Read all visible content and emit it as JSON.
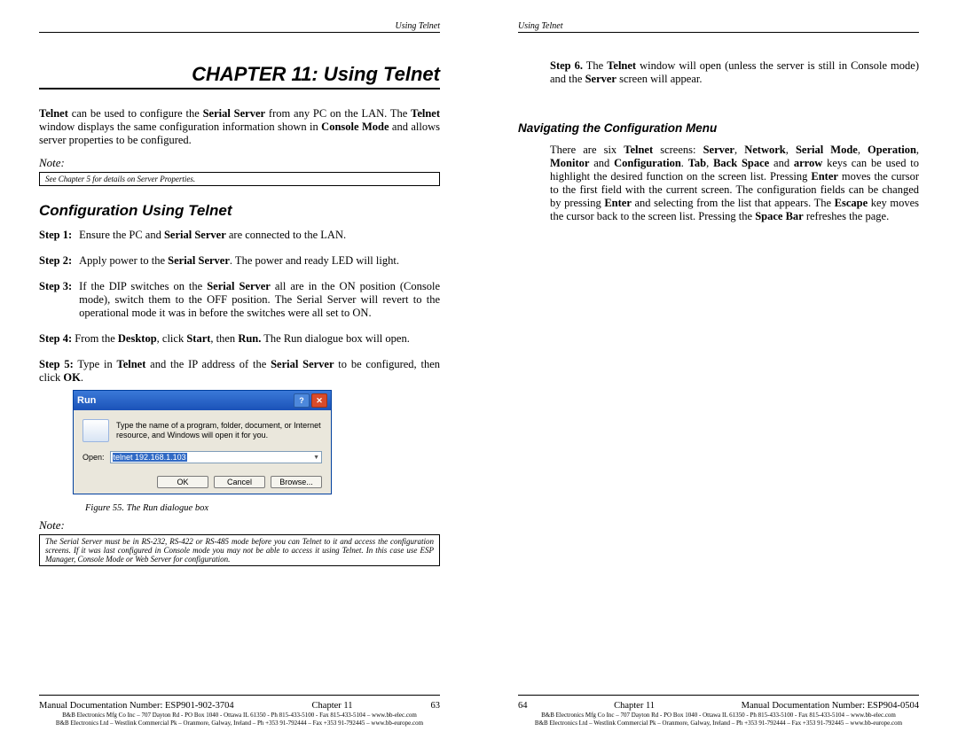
{
  "header_left": "Using Telnet",
  "header_right": "Using Telnet",
  "chapter_title": "CHAPTER 11: Using Telnet",
  "intro_html": "<b>Telnet</b> can be used to configure the <b>Serial Server</b> from any PC on the LAN. The <b>Telnet</b> window displays the same configuration information shown in <b>Console Mode</b> and allows server properties to be configured.",
  "note1_label": "Note:",
  "note1_text": "See Chapter 5 for details on Server Properties.",
  "h2_config": "Configuration Using Telnet",
  "step1_label": "Step 1:",
  "step1_html": "Ensure the PC and <b>Serial Server</b> are connected to the LAN.",
  "step2_label": "Step 2:",
  "step2_html": "Apply power to the <b>Serial Server</b>. The power and ready LED will light.",
  "step3_label": "Step 3:",
  "step3_html": "If the DIP switches on the <b>Serial Server</b> all are in the ON position (Console mode), switch them to the OFF position. The Serial Server will revert to the operational mode it was in before the switches were all set to ON.",
  "step4_html": "<b>Step 4:</b> From the <b>Desktop</b>, click <b>Start</b>, then <b>Run.</b> The Run dialogue box will open.",
  "step5_html": "<b>Step 5:</b> Type in <b>Telnet</b> and the IP address of the <b>Serial Server</b> to be configured, then click <b>OK</b>.",
  "run": {
    "title": "Run",
    "msg": "Type the name of a program, folder, document, or Internet resource, and Windows will open it for you.",
    "open_label": "Open:",
    "open_value": "telnet 192.168.1.103",
    "ok": "OK",
    "cancel": "Cancel",
    "browse": "Browse..."
  },
  "fig_caption": "Figure 55.    The Run dialogue box",
  "note2_label": "Note:",
  "note2_text": "The Serial Server must be in RS-232, RS-422 or RS-485 mode before you can Telnet to it and access the configuration screens. If it was last configured in Console mode you may not be able to access it using Telnet. In this case use ESP Manager, Console Mode or Web Server for configuration.",
  "step6_html": "<b>Step 6.</b> The <b>Telnet</b> window will open (unless the server is still in Console mode) and the <b>Server</b> screen will appear.",
  "h3_nav": "Navigating the Configuration Menu",
  "nav_html": "There are six <b>Telnet</b> screens: <b>Server</b>, <b>Network</b>, <b>Serial Mode</b>, <b>Operation</b>, <b>Monitor</b> and <b>Configuration</b>. <b>Tab</b>, <b>Back Space</b> and <b>arrow</b> keys can be used to highlight the desired function on the screen list. Pressing <b>Enter</b> moves the cursor to the first field with the current screen. The configuration fields can be changed by pressing <b>Enter</b> and selecting from the list that appears. The <b>Escape</b> key moves the cursor back to the screen list. Pressing the <b>Space Bar</b> refreshes the page.",
  "footer_left": {
    "docnum": "Manual Documentation Number: ESP901-902-3704",
    "chapter": "Chapter 11",
    "page": "63",
    "fine1": "B&B Electronics Mfg Co Inc – 707 Dayton Rd - PO Box 1040 - Ottawa IL 61350 - Ph 815-433-5100 - Fax 815-433-5104 – www.bb-elec.com",
    "fine2": "B&B Electronics Ltd – Westlink Commercial Pk – Oranmore, Galway, Ireland – Ph +353 91-792444 – Fax +353 91-792445 – www.bb-europe.com"
  },
  "footer_right": {
    "docnum": "Manual Documentation Number: ESP904-0504",
    "chapter": "Chapter 11",
    "page": "64",
    "fine1": "B&B Electronics Mfg Co Inc – 707 Dayton Rd - PO Box 1040 - Ottawa IL 61350 - Ph 815-433-5100 - Fax 815-433-5104 – www.bb-elec.com",
    "fine2": "B&B Electronics Ltd – Westlink Commercial Pk – Oranmore, Galway, Ireland – Ph +353 91-792444 – Fax +353 91-792445 – www.bb-europe.com"
  }
}
